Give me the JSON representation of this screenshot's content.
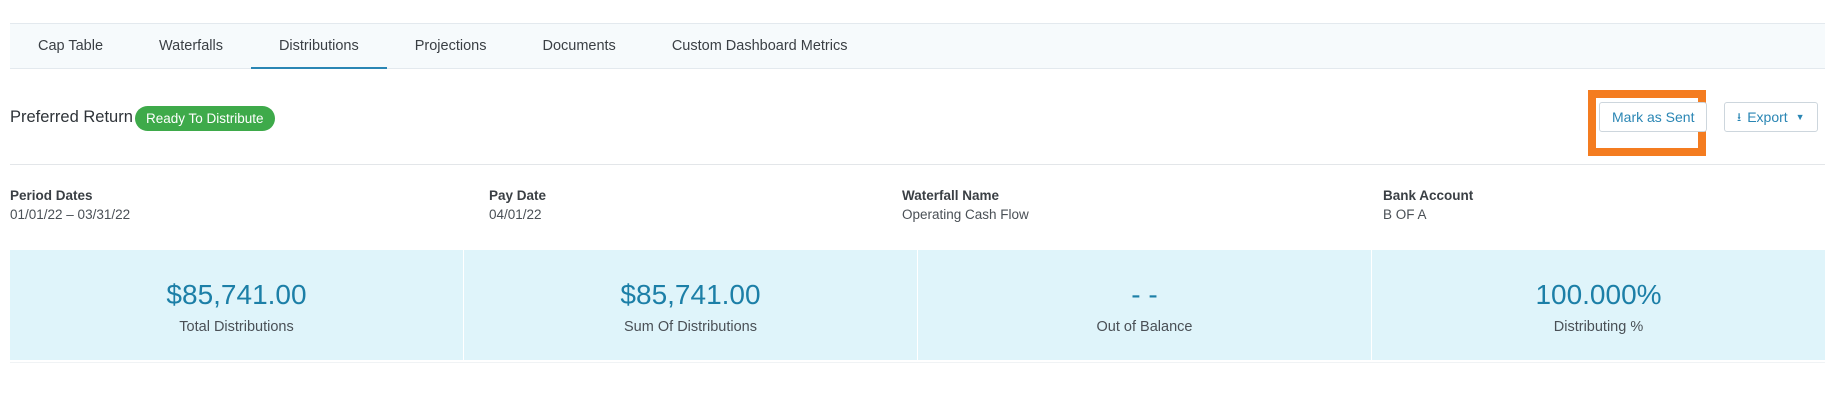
{
  "tabs": [
    {
      "label": "Cap Table",
      "active": false
    },
    {
      "label": "Waterfalls",
      "active": false
    },
    {
      "label": "Distributions",
      "active": true
    },
    {
      "label": "Projections",
      "active": false
    },
    {
      "label": "Documents",
      "active": false
    },
    {
      "label": "Custom Dashboard Metrics",
      "active": false
    }
  ],
  "header": {
    "title": "Preferred Return",
    "status": "Ready To Distribute",
    "mark_sent_label": "Mark as Sent",
    "export_label": "Export"
  },
  "info": [
    {
      "label": "Period Dates",
      "value": "01/01/22 – 03/31/22"
    },
    {
      "label": "Pay Date",
      "value": "04/01/22"
    },
    {
      "label": "Waterfall Name",
      "value": "Operating Cash Flow"
    },
    {
      "label": "Bank Account",
      "value": "B OF A"
    }
  ],
  "metrics": [
    {
      "value": "$85,741.00",
      "label": "Total Distributions"
    },
    {
      "value": "$85,741.00",
      "label": "Sum Of Distributions"
    },
    {
      "value": "- -",
      "label": "Out of Balance"
    },
    {
      "value": "100.000%",
      "label": "Distributing %"
    }
  ],
  "colors": {
    "accent": "#2a86b4",
    "status_green": "#3eaa4a",
    "highlight_orange": "#f47c20",
    "metrics_bg": "#dff4fa"
  },
  "icons": {
    "export": "download-icon",
    "dropdown": "caret-down-icon"
  }
}
